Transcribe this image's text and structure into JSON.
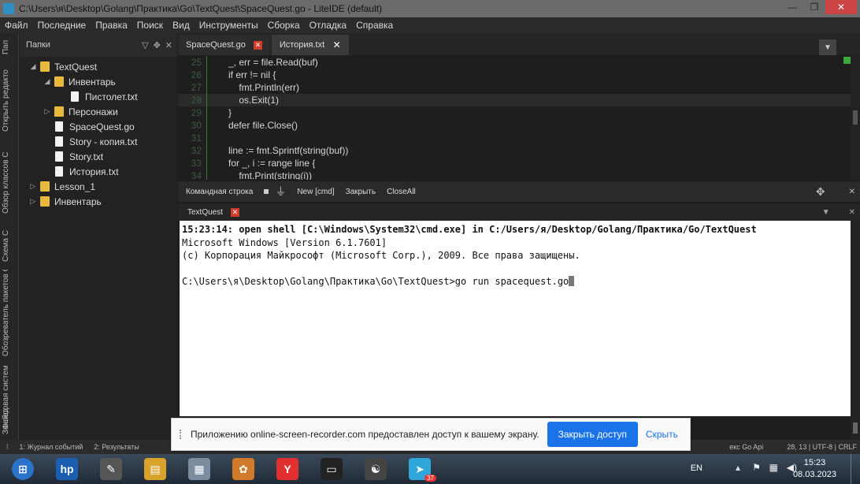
{
  "window": {
    "title": "C:\\Users\\я\\Desktop\\Golang\\Практика\\Go\\TextQuest\\SpaceQuest.go - LiteIDE (default)",
    "min_glyph": "—",
    "max_glyph": "❐",
    "close_glyph": "✕"
  },
  "menu": [
    "Файл",
    "Последние",
    "Правка",
    "Поиск",
    "Вид",
    "Инструменты",
    "Сборка",
    "Отладка",
    "Справка"
  ],
  "sidebar_tabs": [
    "Пап",
    "Открыть редакто",
    "Обзор классов С",
    "Схема С",
    "Обозреватель пакетов С",
    "Файловая систем",
    "Заклад"
  ],
  "folders": {
    "header": "Папки",
    "tree": [
      {
        "label": "TextQuest",
        "kind": "folder",
        "arrow": "◢",
        "depth": 0
      },
      {
        "label": "Инвентарь",
        "kind": "folder",
        "arrow": "◢",
        "depth": 1
      },
      {
        "label": "Пистолет.txt",
        "kind": "file",
        "arrow": "",
        "depth": 2
      },
      {
        "label": "Персонажи",
        "kind": "folder",
        "arrow": "▷",
        "depth": 1
      },
      {
        "label": "SpaceQuest.go",
        "kind": "file",
        "arrow": "",
        "depth": 1
      },
      {
        "label": "Story - копия.txt",
        "kind": "file",
        "arrow": "",
        "depth": 1
      },
      {
        "label": "Story.txt",
        "kind": "file",
        "arrow": "",
        "depth": 1
      },
      {
        "label": "История.txt",
        "kind": "file",
        "arrow": "",
        "depth": 1
      },
      {
        "label": "Lesson_1",
        "kind": "folder",
        "arrow": "▷",
        "depth": 0
      },
      {
        "label": "Инвентарь",
        "kind": "folder",
        "arrow": "▷",
        "depth": 0
      }
    ]
  },
  "editor_tabs": [
    {
      "label": "SpaceQuest.go",
      "close": "✕",
      "active": false
    },
    {
      "label": "История.txt",
      "close": "✕",
      "active": true
    }
  ],
  "code": [
    {
      "n": "25",
      "text": "_, err = file.Read(buf)"
    },
    {
      "n": "26",
      "text": "if err != nil {"
    },
    {
      "n": "27",
      "text": "    fmt.Println(err)"
    },
    {
      "n": "28",
      "text": "    os.Exit(1)"
    },
    {
      "n": "29",
      "text": "}"
    },
    {
      "n": "30",
      "text": "defer file.Close()"
    },
    {
      "n": "31",
      "text": ""
    },
    {
      "n": "32",
      "text": "line := fmt.Sprintf(string(buf))"
    },
    {
      "n": "33",
      "text": "for _, i := range line {"
    },
    {
      "n": "34",
      "text": "    fmt.Print(string(i))"
    }
  ],
  "output_toolbar": {
    "title": "Командная строка",
    "new_cmd": "New [cmd]",
    "close": "Закрыть",
    "close_all": "CloseAll"
  },
  "output_tab": {
    "label": "TextQuest",
    "close": "✕"
  },
  "terminal": [
    "15:23:14: open shell [C:\\Windows\\System32\\cmd.exe] in C:/Users/я/Desktop/Golang/Практика/Go/TextQuest",
    "Microsoft Windows [Version 6.1.7601]",
    "(c) Корпорация Майкрософт (Microsoft Corp.), 2009. Все права защищены.",
    "",
    "C:\\Users\\я\\Desktop\\Golang\\Практика\\Go\\TextQuest>go run spacequest.go"
  ],
  "statusbar": {
    "items": [
      "1: Журнал событий",
      "2: Результаты"
    ],
    "right_text": "екс Go Api",
    "position": "28, 13 | UTF-8 | CRLF"
  },
  "notification": {
    "message": "Приложению online-screen-recorder.com предоставлен доступ к вашему экрану.",
    "stop_button": "Закрыть доступ",
    "hide_link": "Скрыть"
  },
  "taskbar": {
    "apps": [
      {
        "name": "windows-start",
        "glyph": "⊞",
        "color": "#2a73c9"
      },
      {
        "name": "hp",
        "glyph": "hp",
        "color": "#1b5fb0"
      },
      {
        "name": "tool",
        "glyph": "✎",
        "color": "#555"
      },
      {
        "name": "explorer",
        "glyph": "▤",
        "color": "#d9a32b"
      },
      {
        "name": "calculator",
        "glyph": "▦",
        "color": "#7c8ca0"
      },
      {
        "name": "paint",
        "glyph": "✿",
        "color": "#d07a2a"
      },
      {
        "name": "yandex",
        "glyph": "Y",
        "color": "#e23030"
      },
      {
        "name": "cmd",
        "glyph": "▭",
        "color": "#222"
      },
      {
        "name": "liteide",
        "glyph": "☯",
        "color": "#444"
      },
      {
        "name": "telegram",
        "glyph": "➤",
        "color": "#2ea6da"
      }
    ],
    "telegram_badge": "37",
    "lang": "EN",
    "time": "15:23",
    "date": "08.03.2023"
  }
}
